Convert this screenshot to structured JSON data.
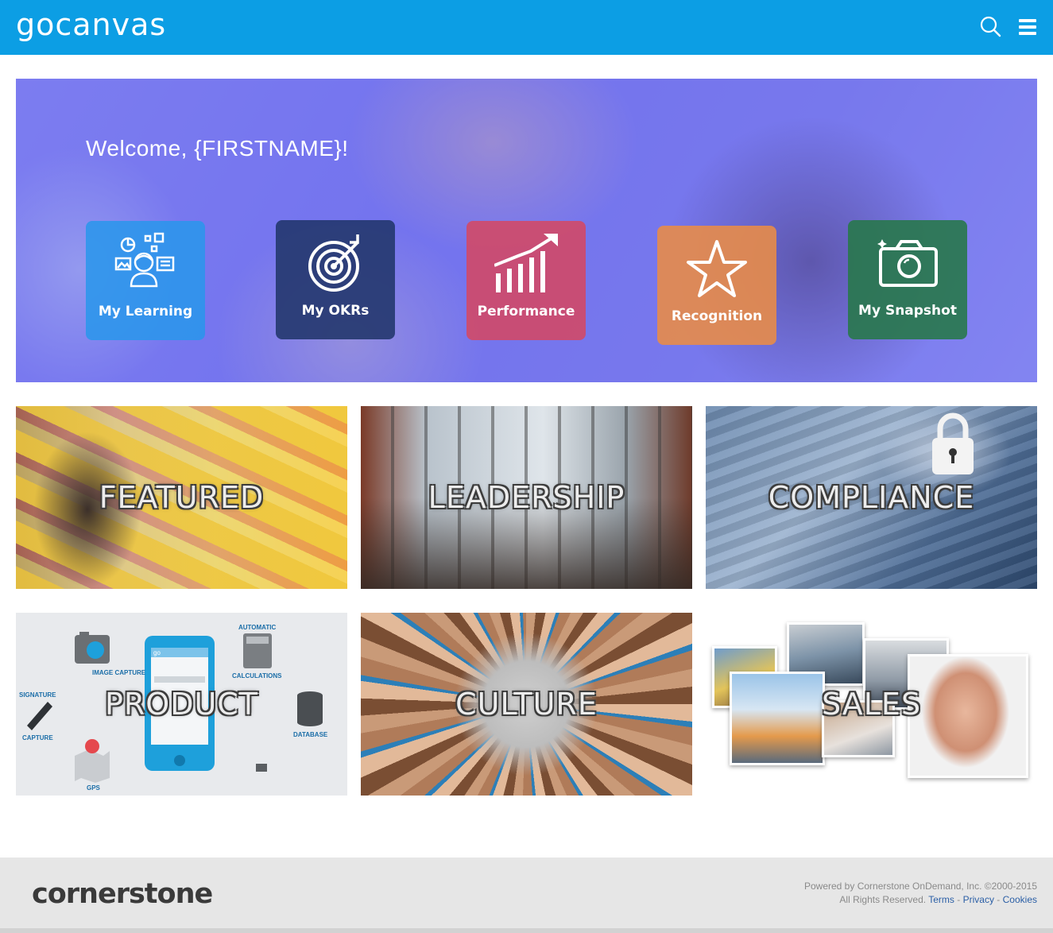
{
  "header": {
    "logo_text": "gocanvas",
    "search_icon": "search-icon",
    "menu_icon": "hamburger-menu-icon",
    "brand_color": "#0c9ee4"
  },
  "hero": {
    "welcome": "Welcome, {FIRSTNAME}!",
    "tiles": [
      {
        "label": "My Learning",
        "icon": "learning-icon",
        "color": "#2896eb"
      },
      {
        "label": "My OKRs",
        "icon": "target-icon",
        "color": "#23376e"
      },
      {
        "label": "Performance",
        "icon": "growth-chart-icon",
        "color": "#d7465f"
      },
      {
        "label": "Recognition",
        "icon": "star-icon",
        "color": "#eb8c46"
      },
      {
        "label": "My Snapshot",
        "icon": "camera-icon",
        "color": "#28784b"
      }
    ]
  },
  "categories": [
    {
      "title": "FEATURED"
    },
    {
      "title": "LEADERSHIP"
    },
    {
      "title": "COMPLIANCE"
    },
    {
      "title": "PRODUCT"
    },
    {
      "title": "CULTURE"
    },
    {
      "title": "SALES"
    }
  ],
  "product_illustration": {
    "labels": {
      "image_capture": "IMAGE CAPTURE",
      "automatic": "AUTOMATIC",
      "calculations": "CALCULATIONS",
      "signature": "SIGNATURE",
      "capture": "CAPTURE",
      "database": "DATABASE",
      "gps": "GPS",
      "phone_text": "go"
    }
  },
  "footer": {
    "logo_text": "cornerstone",
    "powered_by": "Powered by Cornerstone OnDemand, Inc. ©2000-2015",
    "rights": "All Rights Reserved.",
    "terms": "Terms",
    "privacy": "Privacy",
    "cookies": "Cookies",
    "separator": "-"
  }
}
